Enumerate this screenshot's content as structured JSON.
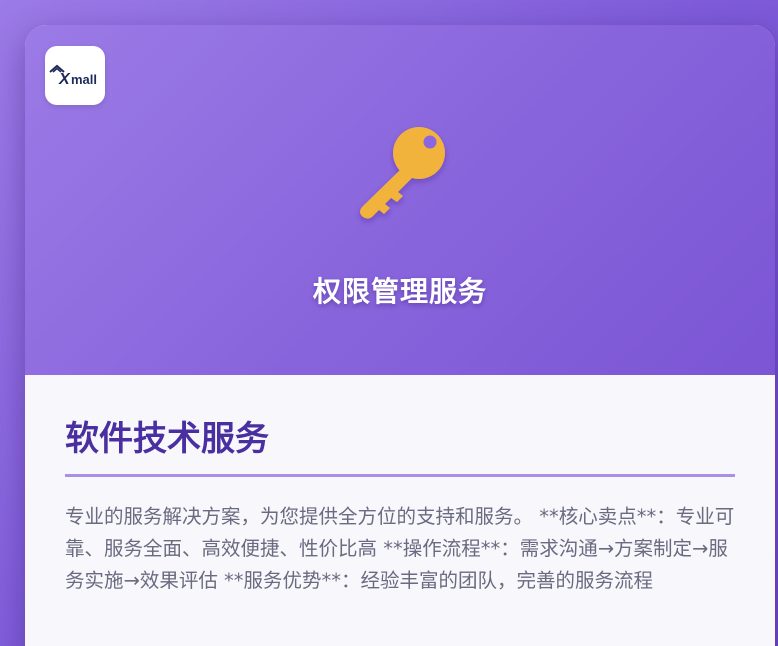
{
  "logo": {
    "text": "Xmall"
  },
  "hero": {
    "title": "权限管理服务",
    "icon": "key-icon"
  },
  "section": {
    "title": "软件技术服务",
    "description": "专业的服务解决方案，为您提供全方位的支持和服务。 **核心卖点**：专业可靠、服务全面、高效便捷、性价比高 **操作流程**：需求沟通→方案制定→服务实施→效果评估 **服务优势**：经验丰富的团队，完善的服务流程"
  },
  "colors": {
    "accent": "#4a2fa0",
    "hero_gradient_start": "#9b7be6",
    "hero_gradient_end": "#7b55d4",
    "key": "#f2b33d"
  }
}
